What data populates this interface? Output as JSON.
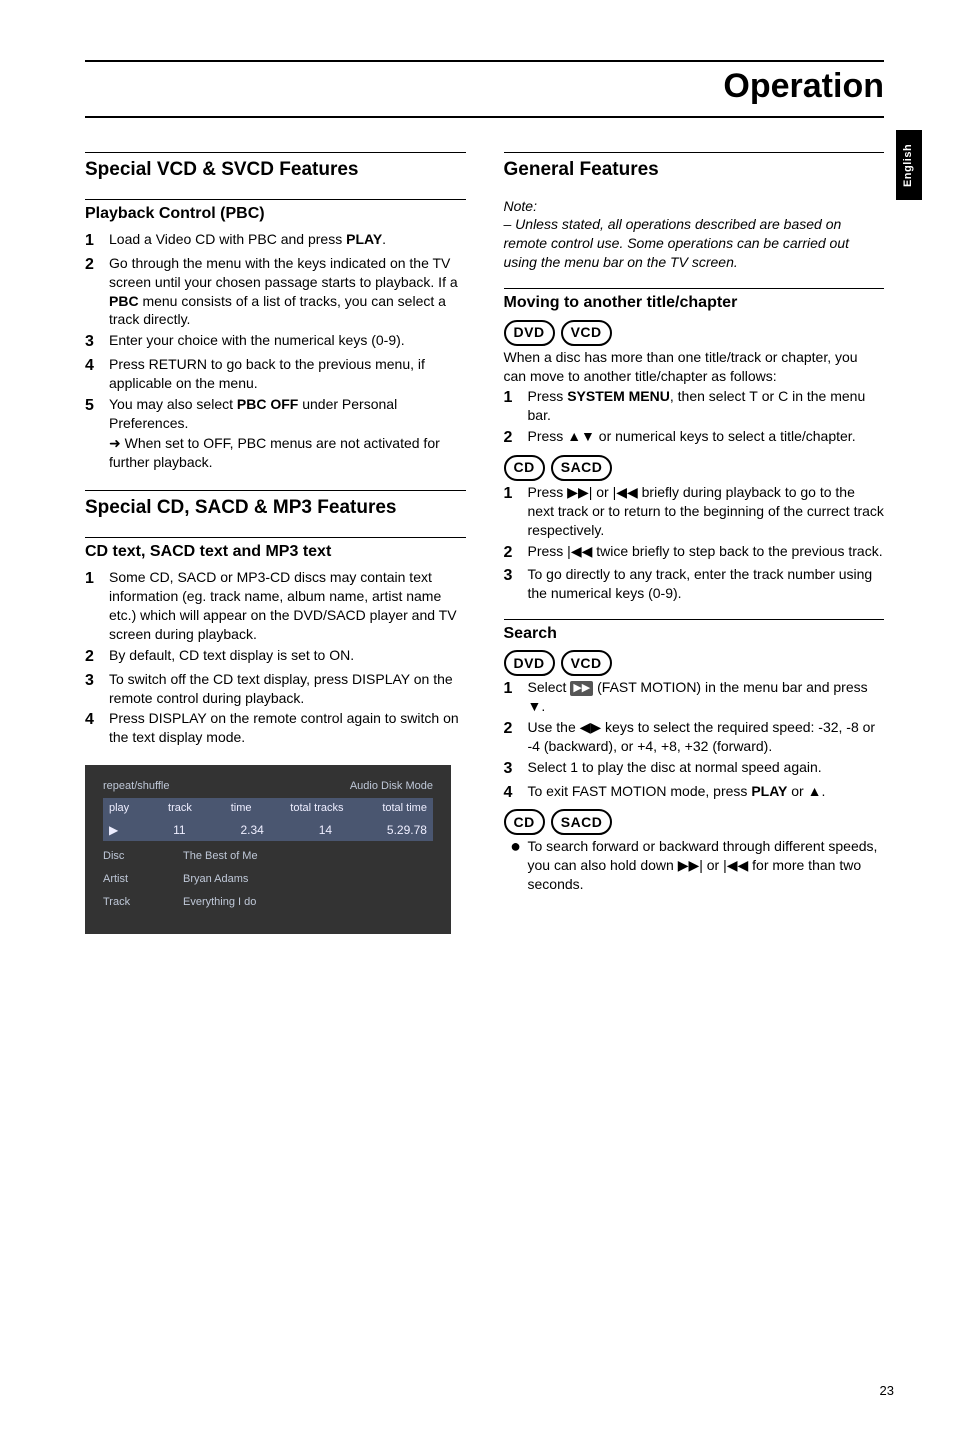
{
  "edge_tab": "English",
  "main_title": "Operation",
  "left": {
    "h1": "Special VCD & SVCD Features",
    "sub1": "Playback Control (PBC)",
    "pbc_steps": [
      {
        "n": "1",
        "t": "Load a Video CD with PBC and press ",
        "bold": "PLAY",
        "tail": "."
      },
      {
        "n": "2",
        "t": "Go through the menu with the keys indicated on the TV screen until your chosen passage starts to playback. If a ",
        "bold": "PBC",
        "tail": " menu consists of a list of tracks, you can select a track directly."
      },
      {
        "n": "3",
        "t": "Enter your choice with the numerical keys (0-9)."
      },
      {
        "n": "4",
        "t": "Press RETURN to go back to the previous menu, if applicable on the menu."
      },
      {
        "n": "5",
        "t": "You may also select ",
        "bold": "PBC OFF",
        "tail": " under Personal Preferences."
      }
    ],
    "pbc_sub": "When set to OFF, PBC menus are not activated for further playback.",
    "h2": "Special CD, SACD & MP3 Features",
    "sub2": "CD text, SACD text and MP3 text",
    "cd_steps": [
      {
        "n": "1",
        "t": "Some CD, SACD or MP3-CD discs may contain text information (eg. track name, album name, artist name etc.) which will appear on the DVD/SACD player and TV screen during playback."
      },
      {
        "n": "2",
        "t": "By default, CD text display is set to ON."
      },
      {
        "n": "3",
        "t": "To switch off the CD text display, press DISPLAY on the remote control during playback."
      },
      {
        "n": "4",
        "t": "Press DISPLAY on the remote control again to switch on the text display mode."
      }
    ],
    "screenshot": {
      "top_left": "repeat/shuffle",
      "top_right": "Audio Disk Mode",
      "cols": [
        "play",
        "track",
        "time",
        "total tracks",
        "total time"
      ],
      "vals": [
        "▶",
        "11",
        "2.34",
        "14",
        "5.29.78"
      ],
      "rows": [
        [
          "Disc",
          "The Best of Me"
        ],
        [
          "Artist",
          "Bryan Adams"
        ],
        [
          "Track",
          "Everything I do"
        ]
      ]
    }
  },
  "right": {
    "h1": "General Features",
    "note_label": "Note:",
    "note_body": "– Unless stated, all operations described are based on remote control use. Some operations can be carried out using the menu bar on the TV screen.",
    "sub1": "Moving to another title/chapter",
    "badges1": [
      "DVD",
      "VCD"
    ],
    "move_intro": "When a disc has more than one title/track or chapter, you can move to another title/chapter as follows:",
    "move_steps": [
      {
        "n": "1",
        "pre": "Press ",
        "bold": "SYSTEM MENU",
        "post": ", then select ",
        "sym1": "T",
        "mid": " or ",
        "sym2": "C",
        "tail": " in the menu bar."
      },
      {
        "n": "2",
        "pre": "Press ",
        "sym": "▲▼",
        "post": " or numerical keys to select a title/chapter."
      }
    ],
    "badges2": [
      "CD",
      "SACD"
    ],
    "cd_steps": [
      {
        "n": "1",
        "t": "Press ▶▶| or |◀◀ briefly during playback to go to the next track or to return to the beginning of the currect track respectively."
      },
      {
        "n": "2",
        "t": "Press |◀◀ twice briefly to step back to the previous track."
      },
      {
        "n": "3",
        "t": "To go directly to any track, enter the track number using the numerical keys (0-9)."
      }
    ],
    "sub2": "Search",
    "badges3": [
      "DVD",
      "VCD"
    ],
    "search_steps": [
      {
        "n": "1",
        "pre": "Select ",
        "icon": "▶▶",
        "post": " (FAST MOTION) in the menu bar and press ▼."
      },
      {
        "n": "2",
        "t": "Use the ◀▶ keys to select the required speed: -32, -8 or -4 (backward), or +4, +8, +32 (forward)."
      },
      {
        "n": "3",
        "t": "Select 1 to play the disc at normal speed again."
      },
      {
        "n": "4",
        "pre": "To exit FAST MOTION mode, press ",
        "bold": "PLAY",
        "post": " or ▲."
      }
    ],
    "badges4": [
      "CD",
      "SACD"
    ],
    "bullet": "To search forward or backward through different speeds, you can also hold down ▶▶| or |◀◀ for more than two seconds."
  },
  "page_number": "23"
}
